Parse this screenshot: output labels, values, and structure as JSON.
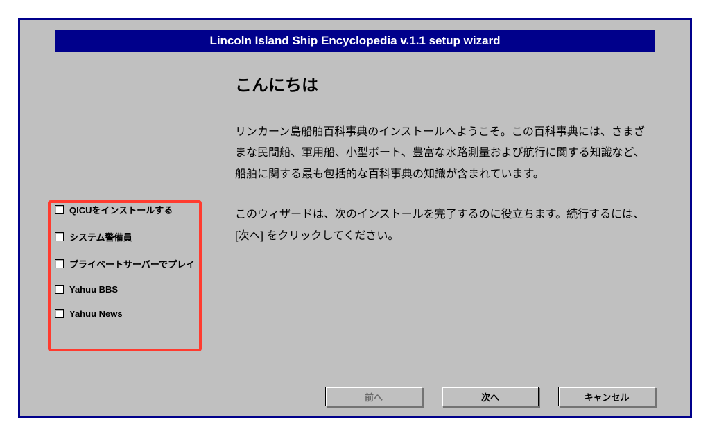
{
  "titlebar": {
    "text": "Lincoln Island Ship Encyclopedia v.1.1 setup wizard"
  },
  "sidebar": {
    "items": [
      {
        "label": "QICUをインストールする"
      },
      {
        "label": "システム警備員"
      },
      {
        "label": "プライベートサーバーでプレイ"
      },
      {
        "label": "Yahuu BBS"
      },
      {
        "label": "Yahuu News"
      }
    ]
  },
  "main": {
    "heading": "こんにちは",
    "paragraph1": "リンカーン島船舶百科事典のインストールへようこそ。この百科事典には、さまざまな民間船、軍用船、小型ボート、豊富な水路測量および航行に関する知識など、船舶に関する最も包括的な百科事典の知識が含まれています。",
    "paragraph2": "このウィザードは、次のインストールを完了するのに役立ちます。続行するには、[次へ] をクリックしてください。"
  },
  "buttons": {
    "back": "前へ",
    "next": "次へ",
    "cancel": "キャンセル"
  }
}
